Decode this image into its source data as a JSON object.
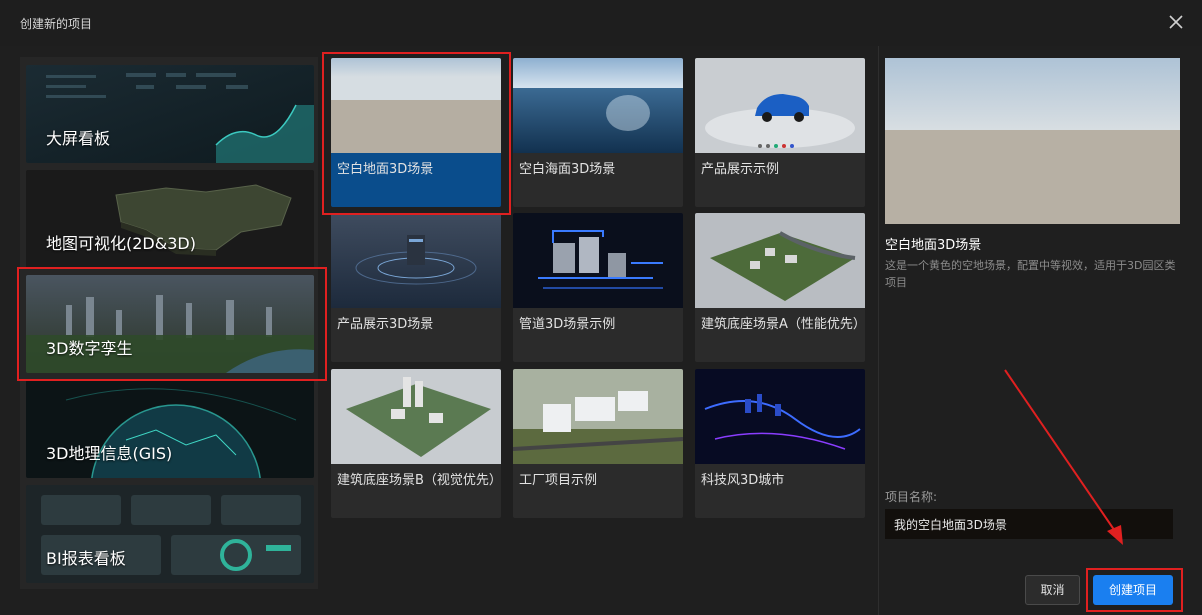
{
  "dialog": {
    "title": "创建新的项目",
    "close_icon": "close-icon"
  },
  "categories": [
    {
      "label": "大屏看板"
    },
    {
      "label": "地图可视化(2D&3D)"
    },
    {
      "label": "3D数字孪生",
      "selected": true
    },
    {
      "label": "3D地理信息(GIS)"
    },
    {
      "label": "BI报表看板"
    }
  ],
  "templates": [
    {
      "label": "空白地面3D场景",
      "selected": true
    },
    {
      "label": "空白海面3D场景"
    },
    {
      "label": "产品展示示例"
    },
    {
      "label": "产品展示3D场景"
    },
    {
      "label": "管道3D场景示例"
    },
    {
      "label": "建筑底座场景A（性能优先）"
    },
    {
      "label": "建筑底座场景B（视觉优先）"
    },
    {
      "label": "工厂项目示例"
    },
    {
      "label": "科技风3D城市"
    }
  ],
  "detail": {
    "title": "空白地面3D场景",
    "description": "这是一个黄色的空地场景，配置中等视效，适用于3D园区类项目",
    "name_label": "项目名称:",
    "name_value": "我的空白地面3D场景"
  },
  "buttons": {
    "cancel": "取消",
    "create": "创建项目"
  },
  "colors": {
    "accent": "#1a7ff0",
    "selected_card": "#0a4d8c",
    "highlight": "#e02020",
    "background": "#1f1f1f"
  }
}
